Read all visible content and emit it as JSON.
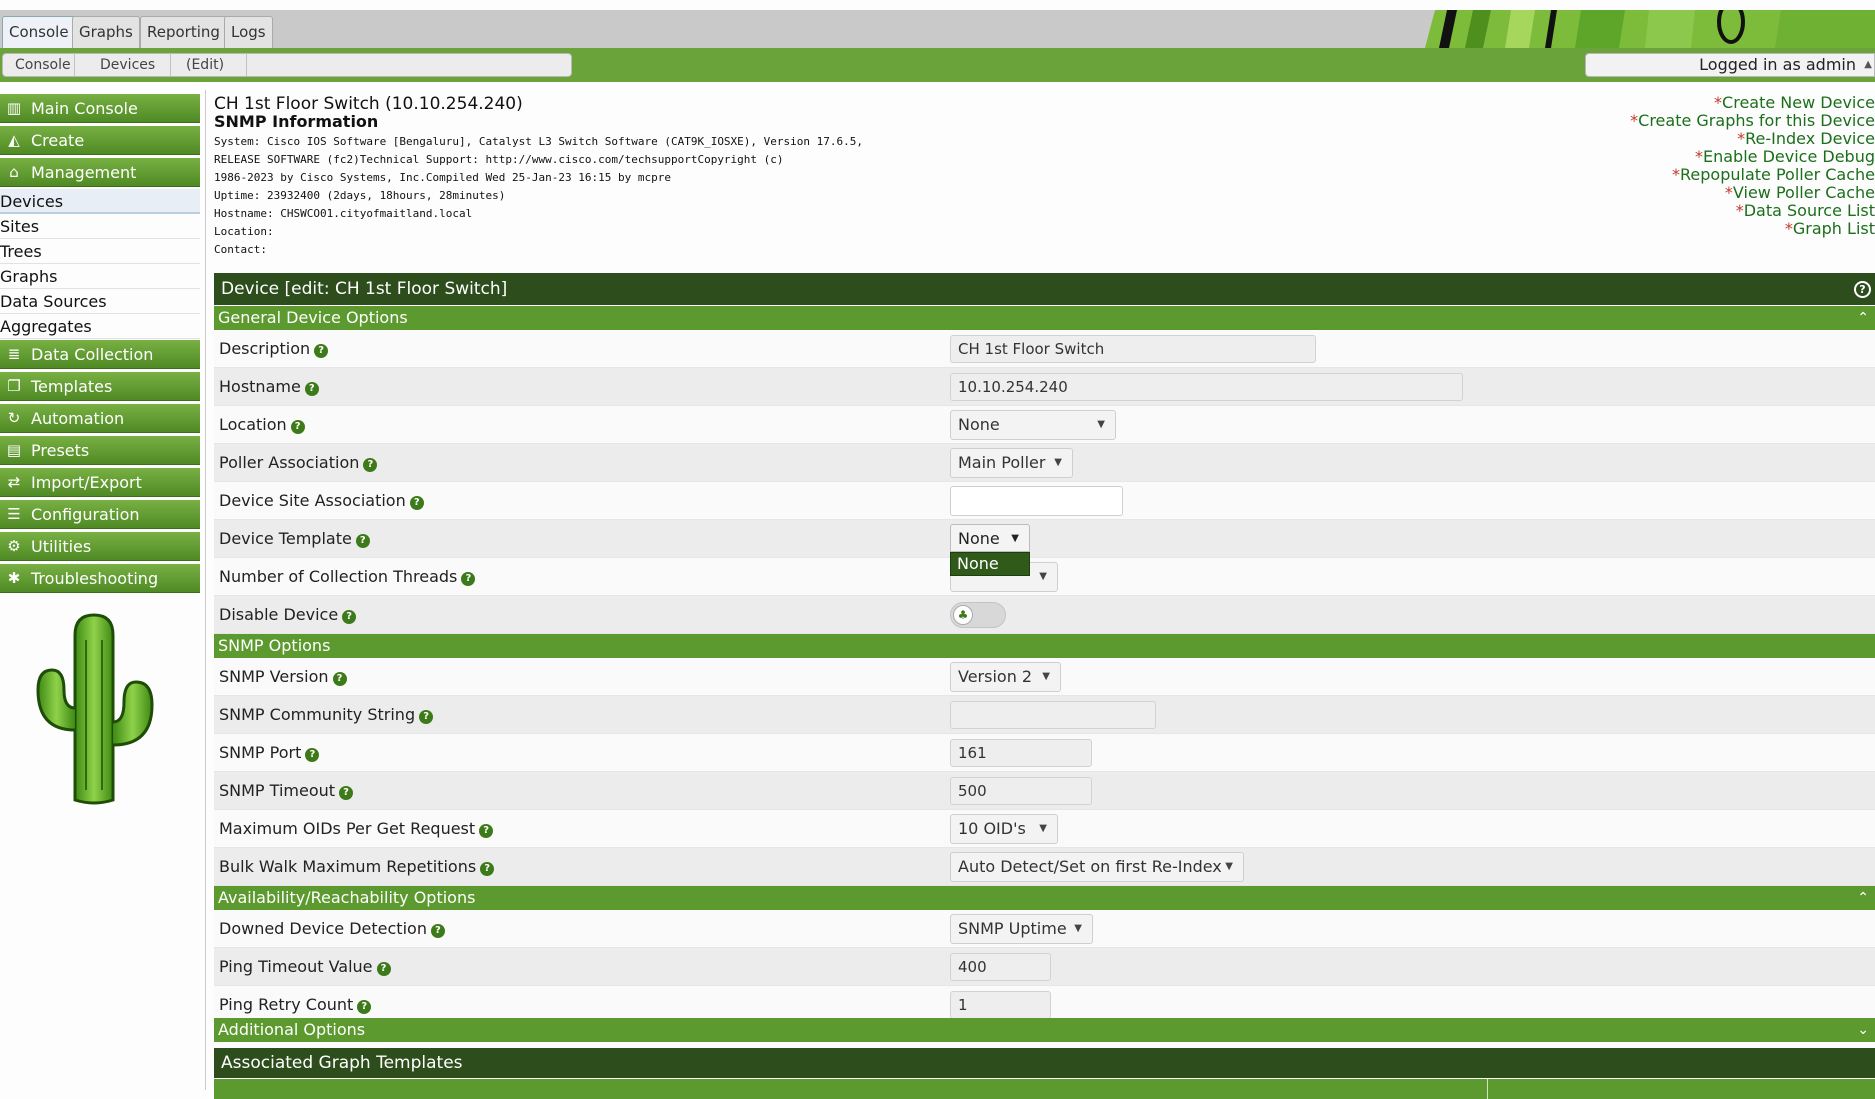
{
  "tabs": [
    "Console",
    "Graphs",
    "Reporting",
    "Logs"
  ],
  "breadcrumb": [
    "Console",
    "Devices",
    "(Edit)"
  ],
  "login_text": "Logged in as admin",
  "sidebar": {
    "main_console": "Main Console",
    "create": "Create",
    "management": "Management",
    "management_items": [
      "Devices",
      "Sites",
      "Trees",
      "Graphs",
      "Data Sources",
      "Aggregates"
    ],
    "data_collection": "Data Collection",
    "templates": "Templates",
    "automation": "Automation",
    "presets": "Presets",
    "import_export": "Import/Export",
    "configuration": "Configuration",
    "utilities": "Utilities",
    "troubleshooting": "Troubleshooting"
  },
  "device": {
    "title": "CH 1st Floor Switch (10.10.254.240)",
    "snmp_heading": "SNMP Information",
    "system_lines": [
      "System: Cisco IOS Software [Bengaluru], Catalyst L3 Switch Software (CAT9K_IOSXE), Version 17.6.5,",
      "RELEASE SOFTWARE (fc2)Technical Support: http://www.cisco.com/techsupportCopyright (c)",
      "1986-2023 by Cisco Systems, Inc.Compiled Wed 25-Jan-23 16:15 by mcpre",
      "Uptime: 23932400 (2days, 18hours, 28minutes)",
      "Hostname: CHSWCO01.cityofmaitland.local",
      "Location:",
      "Contact:"
    ]
  },
  "actions": [
    "Create New Device",
    "Create Graphs for this Device",
    "Re-Index Device",
    "Enable Device Debug",
    "Repopulate Poller Cache",
    "View Poller Cache",
    "Data Source List",
    "Graph List"
  ],
  "panel_title": "Device [edit: CH 1st Floor Switch]",
  "sections": {
    "general": "General Device Options",
    "snmp": "SNMP Options",
    "availability": "Availability/Reachability Options",
    "additional": "Additional Options"
  },
  "fields": {
    "description": {
      "label": "Description",
      "value": "CH 1st Floor Switch"
    },
    "hostname": {
      "label": "Hostname",
      "value": "10.10.254.240"
    },
    "location": {
      "label": "Location",
      "value": "None"
    },
    "poller": {
      "label": "Poller Association",
      "value": "Main Poller"
    },
    "site": {
      "label": "Device Site Association",
      "value": ""
    },
    "template": {
      "label": "Device Template",
      "value": "None",
      "dropdown_option": "None"
    },
    "threads": {
      "label": "Number of Collection Threads"
    },
    "disable": {
      "label": "Disable Device"
    },
    "snmp_version": {
      "label": "SNMP Version",
      "value": "Version 2"
    },
    "community": {
      "label": "SNMP Community String",
      "value": ""
    },
    "snmp_port": {
      "label": "SNMP Port",
      "value": "161"
    },
    "snmp_timeout": {
      "label": "SNMP Timeout",
      "value": "500"
    },
    "max_oids": {
      "label": "Maximum OIDs Per Get Request",
      "value": "10 OID's"
    },
    "bulk_walk": {
      "label": "Bulk Walk Maximum Repetitions",
      "value": "Auto Detect/Set on first Re-Index"
    },
    "downed": {
      "label": "Downed Device Detection",
      "value": "SNMP Uptime"
    },
    "ping_timeout": {
      "label": "Ping Timeout Value",
      "value": "400"
    },
    "ping_retry": {
      "label": "Ping Retry Count",
      "value": "1"
    }
  },
  "assoc_title": "Associated Graph Templates",
  "colors": {
    "brand_green": "#5c9a2f",
    "dark_green": "#2e4d1c",
    "link_green": "#1b6f1b"
  }
}
